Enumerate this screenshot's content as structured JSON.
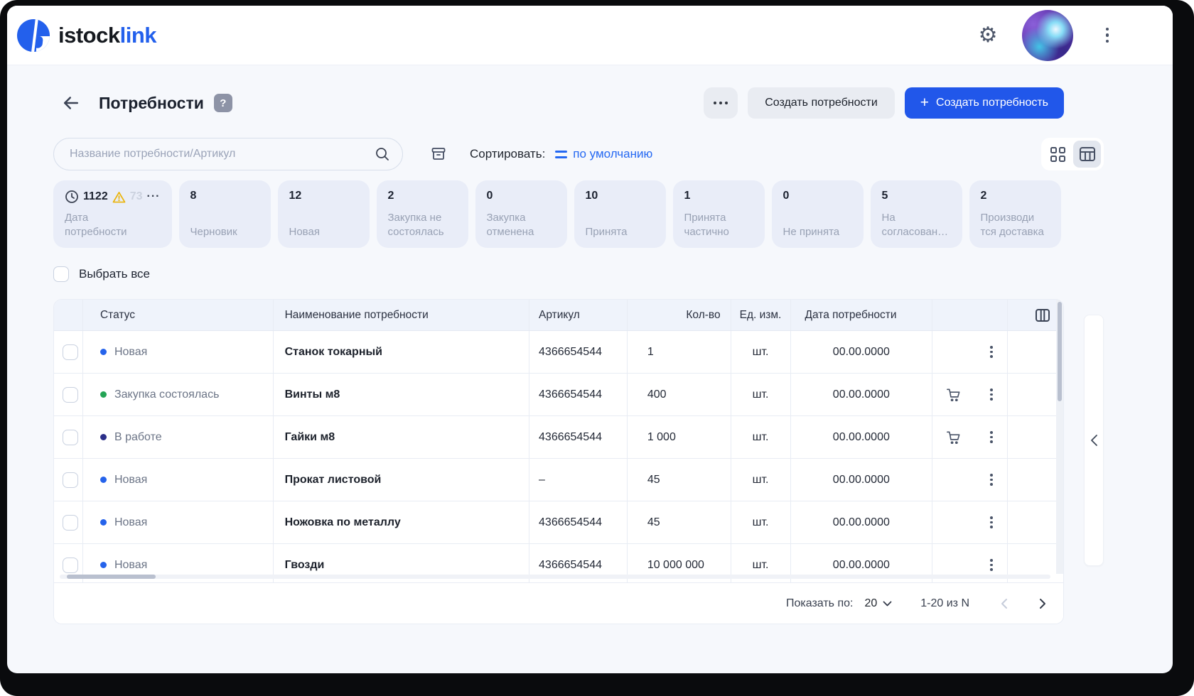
{
  "brand": {
    "part_black": "istock",
    "part_blue": "link"
  },
  "header": {
    "title": "Потребности",
    "help": "?",
    "create_secondary": "Создать потребности",
    "create_primary": "Создать потребность",
    "plus": "+"
  },
  "toolbar": {
    "search_placeholder": "Название потребности/Артикул",
    "sort_label": "Сортировать:",
    "sort_value": "по умолчанию"
  },
  "filters": [
    {
      "count": "1122",
      "extra_count": "73",
      "label": "Дата\nпотребности"
    },
    {
      "count": "8",
      "label": "Черновик"
    },
    {
      "count": "12",
      "label": "Новая"
    },
    {
      "count": "2",
      "label": "Закупка не\nсостоялась"
    },
    {
      "count": "0",
      "label": "Закупка\nотменена"
    },
    {
      "count": "10",
      "label": "Принята"
    },
    {
      "count": "1",
      "label": "Принята\nчастично"
    },
    {
      "count": "0",
      "label": "Не принята"
    },
    {
      "count": "5",
      "label": "На\nсогласован…"
    },
    {
      "count": "2",
      "label": "Производи\nтся доставка"
    }
  ],
  "select_all_label": "Выбрать все",
  "table": {
    "columns": {
      "status": "Статус",
      "name": "Наименование потребности",
      "sku": "Артикул",
      "qty": "Кол-во",
      "unit": "Ед. изм.",
      "date": "Дата потребности"
    },
    "rows": [
      {
        "status": "Новая",
        "status_color": "#2563eb",
        "name": "Станок токарный",
        "sku": "4366654544",
        "qty": "1",
        "unit": "шт.",
        "date": "00.00.0000",
        "cart": false
      },
      {
        "status": "Закупка состоялась",
        "status_color": "#23a455",
        "name": "Винты м8",
        "sku": "4366654544",
        "qty": "400",
        "unit": "шт.",
        "date": "00.00.0000",
        "cart": true
      },
      {
        "status": "В работе",
        "status_color": "#2b2f89",
        "name": "Гайки м8",
        "sku": "4366654544",
        "qty": "1 000",
        "unit": "шт.",
        "date": "00.00.0000",
        "cart": true
      },
      {
        "status": "Новая",
        "status_color": "#2563eb",
        "name": "Прокат листовой",
        "sku": "–",
        "qty": "45",
        "unit": "шт.",
        "date": "00.00.0000",
        "cart": false
      },
      {
        "status": "Новая",
        "status_color": "#2563eb",
        "name": "Ножовка по металлу",
        "sku": "4366654544",
        "qty": "45",
        "unit": "шт.",
        "date": "00.00.0000",
        "cart": false
      },
      {
        "status": "Новая",
        "status_color": "#2563eb",
        "name": "Гвозди",
        "sku": "4366654544",
        "qty": "10 000 000",
        "unit": "шт.",
        "date": "00.00.0000",
        "cart": false
      }
    ]
  },
  "pagination": {
    "show_label": "Показать по:",
    "page_size": "20",
    "range": "1-20 из N"
  },
  "icons": {
    "settings": "gear",
    "user_menu": "kebab-vertical",
    "back": "arrow-left",
    "help": "question-badge",
    "more": "kebab-horizontal",
    "search": "magnifier",
    "archive": "archive-box",
    "sort": "equals-lines",
    "view_grid": "grid-2x2",
    "view_table": "table-grid",
    "clock": "clock",
    "warning": "warning-triangle",
    "columns": "table-columns",
    "cart": "shopping-cart",
    "row_menu": "kebab-vertical",
    "collapse": "chevron-left",
    "prev": "chevron-left",
    "next": "chevron-right",
    "page_size_dropdown": "chevron-down"
  },
  "colors": {
    "accent": "#2157ea",
    "link": "#2468f2",
    "warning": "#eab308",
    "status_new": "#2563eb",
    "status_purchased": "#23a455",
    "status_in_progress": "#2b2f89"
  }
}
